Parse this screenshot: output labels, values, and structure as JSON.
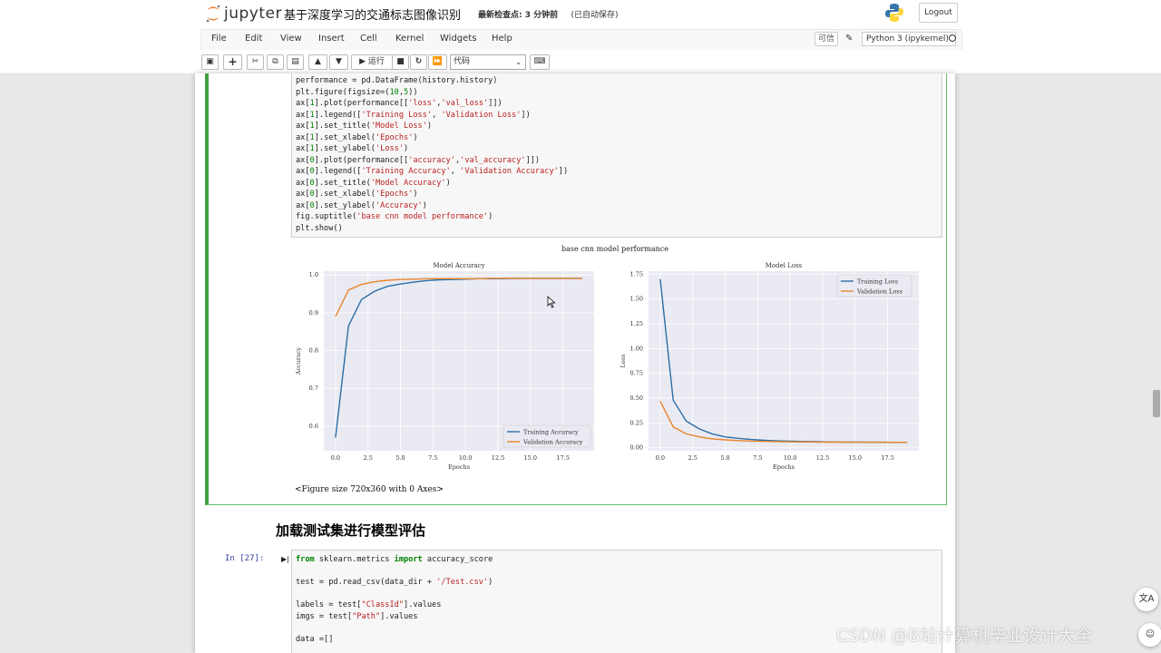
{
  "header": {
    "logo_text": "jupyter",
    "notebook_title": "基于深度学习的交通标志图像识别",
    "checkpoint": "最新检查点: 3 分钟前",
    "autosave": "(已自动保存)",
    "logout_label": "Logout"
  },
  "menu": {
    "items": [
      "File",
      "Edit",
      "View",
      "Insert",
      "Cell",
      "Kernel",
      "Widgets",
      "Help"
    ],
    "trusted": "可信",
    "kernel": "Python 3 (ipykernel)"
  },
  "toolbar": {
    "run_label": "运行",
    "cell_type": "代码",
    "icons": [
      "save-icon",
      "plus-icon",
      "cut-icon",
      "copy-icon",
      "paste-icon",
      "arrow-up-icon",
      "arrow-down-icon",
      "run-icon",
      "stop-icon",
      "restart-icon",
      "fast-forward-icon",
      "keyboard-icon"
    ]
  },
  "cell1": {
    "code_lines": [
      "performance = pd.DataFrame(history.history)",
      "plt.figure(figsize=(10,5))",
      "ax[1].plot(performance[['loss','val_loss']])",
      "ax[1].legend(['Training Loss', 'Validation Loss'])",
      "ax[1].set_title('Model Loss')",
      "ax[1].set_xlabel('Epochs')",
      "ax[1].set_ylabel('Loss')",
      "ax[0].plot(performance[['accuracy','val_accuracy']])",
      "ax[0].legend(['Training Accuracy', 'Validation Accuracy'])",
      "ax[0].set_title('Model Accuracy')",
      "ax[0].set_xlabel('Epochs')",
      "ax[0].set_ylabel('Accuracy')",
      "fig.suptitle('base cnn model performance')",
      "plt.show()"
    ],
    "figure_caption": "<Figure size 720x360 with 0 Axes>"
  },
  "figure": {
    "suptitle": "base cnn model performance"
  },
  "chart_data": [
    {
      "type": "line",
      "title": "Model Accuracy",
      "xlabel": "Epochs",
      "ylabel": "Accuracy",
      "xlim": [
        -0.9,
        19.9
      ],
      "ylim": [
        0.535,
        1.01
      ],
      "xticks": [
        "0.0",
        "2.5",
        "5.0",
        "7.5",
        "10.0",
        "12.5",
        "15.0",
        "17.5"
      ],
      "yticks": [
        "0.6",
        "0.7",
        "0.8",
        "0.9",
        "1.0"
      ],
      "grid": true,
      "legend_position": "bottom-right",
      "x": [
        0,
        1,
        2,
        3,
        4,
        5,
        6,
        7,
        8,
        9,
        10,
        11,
        12,
        13,
        14,
        15,
        16,
        17,
        18,
        19
      ],
      "series": [
        {
          "name": "Training Accuracy",
          "color": "#2a6ea6",
          "values": [
            0.57,
            0.865,
            0.935,
            0.957,
            0.97,
            0.976,
            0.981,
            0.985,
            0.987,
            0.988,
            0.989,
            0.99,
            0.99,
            0.99,
            0.991,
            0.991,
            0.991,
            0.991,
            0.991,
            0.991
          ]
        },
        {
          "name": "Validation Accuracy",
          "color": "#e8852c",
          "values": [
            0.89,
            0.96,
            0.975,
            0.982,
            0.986,
            0.988,
            0.989,
            0.99,
            0.99,
            0.99,
            0.99,
            0.99,
            0.991,
            0.991,
            0.991,
            0.991,
            0.991,
            0.991,
            0.991,
            0.991
          ]
        }
      ]
    },
    {
      "type": "line",
      "title": "Model Loss",
      "xlabel": "Epochs",
      "ylabel": "Loss",
      "xlim": [
        -0.9,
        19.9
      ],
      "ylim": [
        -0.03,
        1.78
      ],
      "xticks": [
        "0.0",
        "2.5",
        "5.0",
        "7.5",
        "10.0",
        "12.5",
        "15.0",
        "17.5"
      ],
      "yticks": [
        "0.00",
        "0.25",
        "0.50",
        "0.75",
        "1.00",
        "1.25",
        "1.50",
        "1.75"
      ],
      "grid": true,
      "legend_position": "top-right",
      "x": [
        0,
        1,
        2,
        3,
        4,
        5,
        6,
        7,
        8,
        9,
        10,
        11,
        12,
        13,
        14,
        15,
        16,
        17,
        18,
        19
      ],
      "series": [
        {
          "name": "Training Loss",
          "color": "#2a6ea6",
          "values": [
            1.7,
            0.48,
            0.27,
            0.19,
            0.14,
            0.11,
            0.095,
            0.083,
            0.075,
            0.07,
            0.066,
            0.063,
            0.061,
            0.059,
            0.058,
            0.057,
            0.056,
            0.056,
            0.055,
            0.055
          ]
        },
        {
          "name": "Validation Loss",
          "color": "#e8852c",
          "values": [
            0.47,
            0.21,
            0.14,
            0.11,
            0.09,
            0.08,
            0.072,
            0.067,
            0.064,
            0.062,
            0.06,
            0.059,
            0.058,
            0.057,
            0.057,
            0.056,
            0.056,
            0.056,
            0.055,
            0.055
          ]
        }
      ]
    }
  ],
  "section_heading": "加载测试集进行模型评估",
  "cell2": {
    "prompt": "In [27]:",
    "code_lines": [
      "from sklearn.metrics import accuracy_score",
      "",
      "test = pd.read_csv(data_dir + '/Test.csv')",
      "",
      "labels = test[\"ClassId\"].values",
      "imgs = test[\"Path\"].values",
      "",
      "data =[]"
    ]
  },
  "watermark": "CSDN @B站计算机毕业设计大全"
}
